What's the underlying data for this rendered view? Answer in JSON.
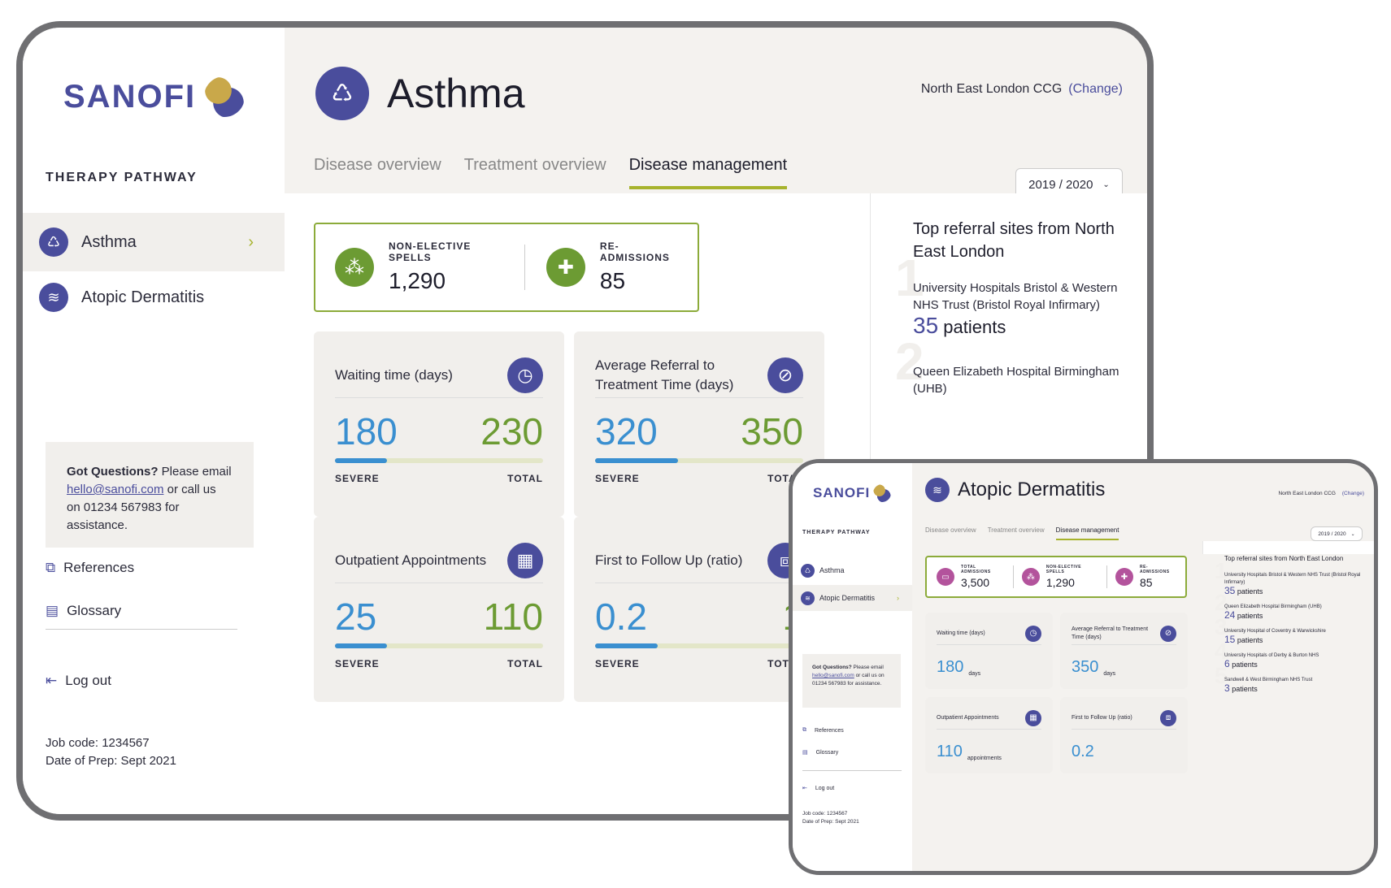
{
  "brand": {
    "name": "SANOFI"
  },
  "colors": {
    "accent": "#4a4d9c",
    "green": "#6c9b33",
    "blue": "#3a8fd0",
    "lime": "#a7b32d"
  },
  "big": {
    "sidebar": {
      "section": "THERAPY PATHWAY",
      "items": [
        {
          "label": "Asthma",
          "icon": "lungs-icon"
        },
        {
          "label": "Atopic Dermatitis",
          "icon": "skin-icon"
        }
      ],
      "q1": "Got Questions?",
      "q2": " Please email ",
      "email": "hello@sanofi.com",
      "q3": " or call us on 01234 567983 for assistance.",
      "references": "References",
      "glossary": "Glossary",
      "logout": "Log out",
      "job_code": "Job code: 1234567",
      "date_prep": "Date of Prep: Sept 2021"
    },
    "header": {
      "title": "Asthma",
      "ccg": "North East London CCG",
      "change": "(Change)",
      "tabs": [
        "Disease overview",
        "Treatment overview",
        "Disease management"
      ],
      "year": "2019 / 2020"
    },
    "kpis": [
      {
        "label": "NON-ELECTIVE SPELLS",
        "value": "1,290"
      },
      {
        "label": "RE-ADMISSIONS",
        "value": "85"
      }
    ],
    "cards": [
      {
        "title": "Waiting time (days)",
        "severe": "180",
        "total": "230",
        "fill": 0.25,
        "sev_label": "SEVERE",
        "tot_label": "TOTAL"
      },
      {
        "title": "Average Referral to Treatment Time (days)",
        "severe": "320",
        "total": "350",
        "fill": 0.4,
        "sev_label": "SEVERE",
        "tot_label": "TOTAL"
      },
      {
        "title": "Outpatient Appointments",
        "severe": "25",
        "total": "110",
        "fill": 0.25,
        "sev_label": "SEVERE",
        "tot_label": "TOTAL"
      },
      {
        "title": "First to Follow Up (ratio)",
        "severe": "0.2",
        "total": "1",
        "fill": 0.3,
        "sev_label": "SEVERE",
        "tot_label": "TOTAL"
      }
    ],
    "referral": {
      "title": "Top referral sites from North East London",
      "sites": [
        {
          "num": "1",
          "name": "University Hospitals Bristol & Western NHS Trust (Bristol Royal Infirmary)",
          "count": "35",
          "unit": "patients"
        },
        {
          "num": "2",
          "name": "Queen Elizabeth Hospital Birmingham (UHB)",
          "count": "",
          "unit": ""
        }
      ]
    }
  },
  "small": {
    "sidebar": {
      "section": "THERAPY PATHWAY",
      "items": [
        {
          "label": "Asthma"
        },
        {
          "label": "Atopic Dermatitis"
        }
      ],
      "q1": "Got Questions?",
      "q2": " Please email ",
      "email": "hello@sanofi.com",
      "q3": " or call us on 01234 567983 for assistance.",
      "references": "References",
      "glossary": "Glossary",
      "logout": "Log out",
      "job_code": "Job code: 1234567",
      "date_prep": "Date of Prep: Sept 2021"
    },
    "header": {
      "title": "Atopic Dermatitis",
      "ccg": "North East London CCG",
      "change": "(Change)",
      "tabs": [
        "Disease overview",
        "Treatment overview",
        "Disease management"
      ],
      "year": "2019 / 2020"
    },
    "kpis": [
      {
        "label": "TOTAL ADMISSIONS",
        "value": "3,500"
      },
      {
        "label": "NON-ELECTIVE SPELLS",
        "value": "1,290"
      },
      {
        "label": "RE-ADMISSIONS",
        "value": "85"
      }
    ],
    "cards": [
      {
        "title": "Waiting time (days)",
        "value": "180",
        "unit": "days"
      },
      {
        "title": "Average Referral to Treatment Time (days)",
        "value": "350",
        "unit": "days"
      },
      {
        "title": "Outpatient Appointments",
        "value": "110",
        "unit": "appointments"
      },
      {
        "title": "First to Follow Up (ratio)",
        "value": "0.2",
        "unit": ""
      }
    ],
    "referral": {
      "title": "Top referral sites from North East London",
      "sites": [
        {
          "num": "1",
          "name": "University Hospitals Bristol & Western NHS Trust (Bristol Royal Infirmary)",
          "count": "35",
          "unit": "patients"
        },
        {
          "num": "2",
          "name": "Queen Elizabeth Hospital Birmingham (UHB)",
          "count": "24",
          "unit": "patients"
        },
        {
          "num": "3",
          "name": "University Hospital of Coventry & Warwickshire",
          "count": "15",
          "unit": "patients"
        },
        {
          "num": "4",
          "name": "University Hospitals of Derby & Burton NHS",
          "count": "6",
          "unit": "patients"
        },
        {
          "num": "5",
          "name": "Sandwell & West Birmingham NHS Trust",
          "count": "3",
          "unit": "patients"
        }
      ]
    }
  }
}
